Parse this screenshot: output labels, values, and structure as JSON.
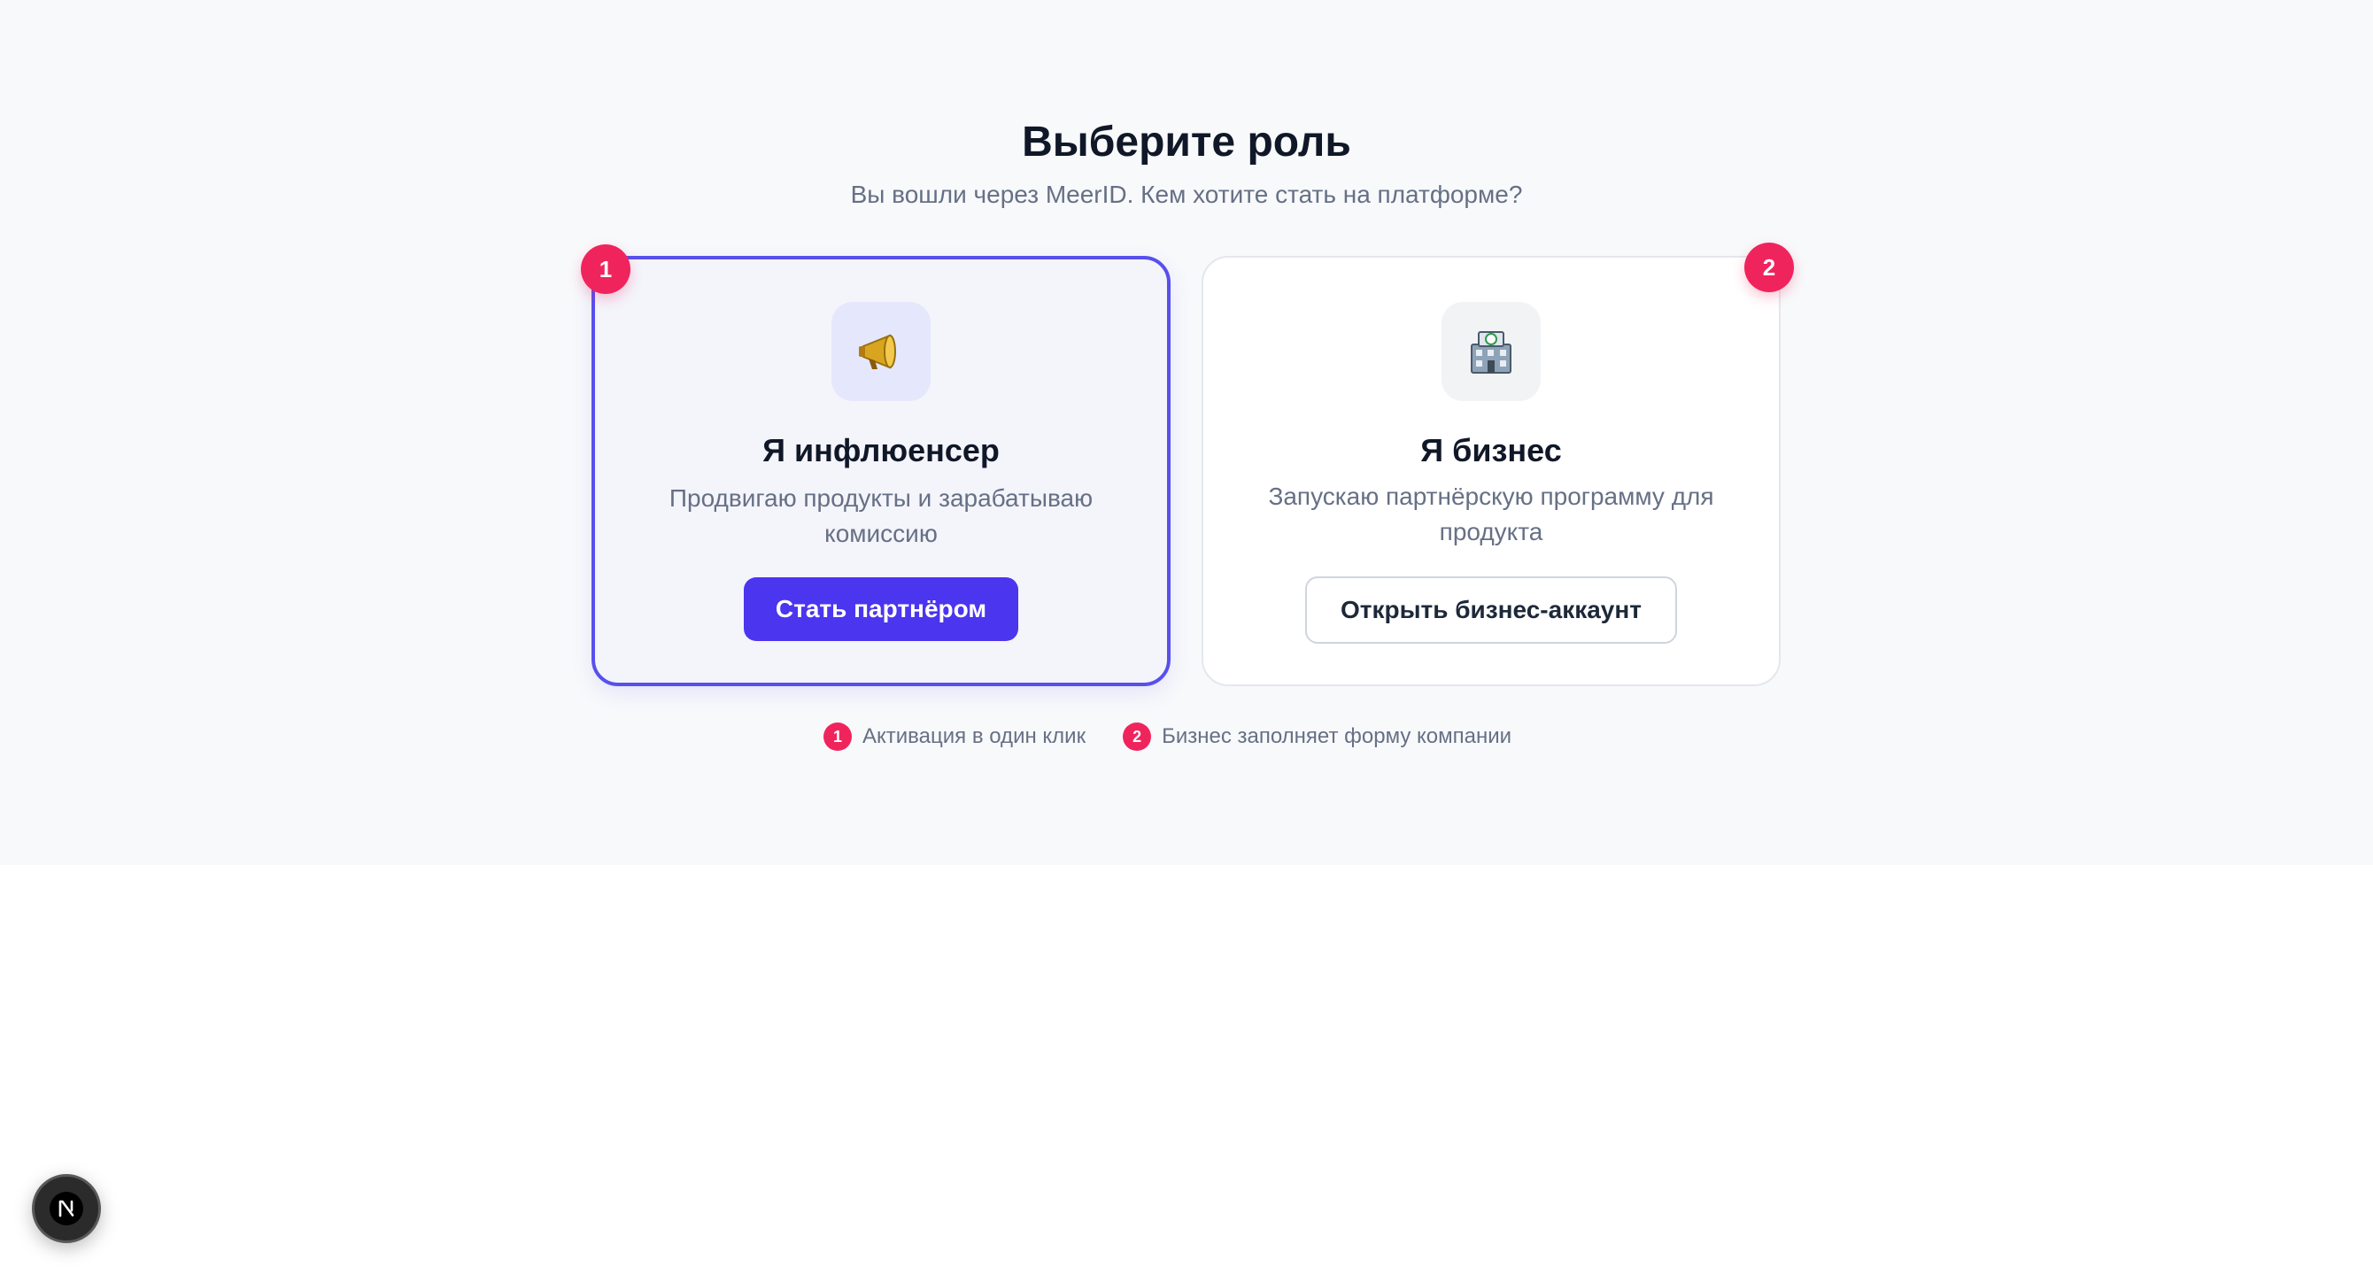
{
  "header": {
    "title": "Выберите роль",
    "subtitle": "Вы вошли через MeerID. Кем хотите стать на платформе?"
  },
  "cards": [
    {
      "badge": "1",
      "icon": "megaphone-icon",
      "title": "Я инфлюенсер",
      "description": "Продвигаю продукты и зарабатываю комиссию",
      "button_label": "Стать партнёром",
      "selected": true
    },
    {
      "badge": "2",
      "icon": "building-icon",
      "title": "Я бизнес",
      "description": "Запускаю партнёрскую программу для продукта",
      "button_label": "Открыть бизнес-аккаунт",
      "selected": false
    }
  ],
  "legend": [
    {
      "badge": "1",
      "text": "Активация в один клик"
    },
    {
      "badge": "2",
      "text": "Бизнес заполняет форму компании"
    }
  ],
  "devtools": {
    "icon": "nextjs-logo-icon",
    "label": "N"
  },
  "colors": {
    "accent": "#4b35ef",
    "selected_border": "#5850ec",
    "badge": "#f0245c",
    "title": "#101828",
    "muted_text": "#667085",
    "background": "#f8f9fb"
  }
}
